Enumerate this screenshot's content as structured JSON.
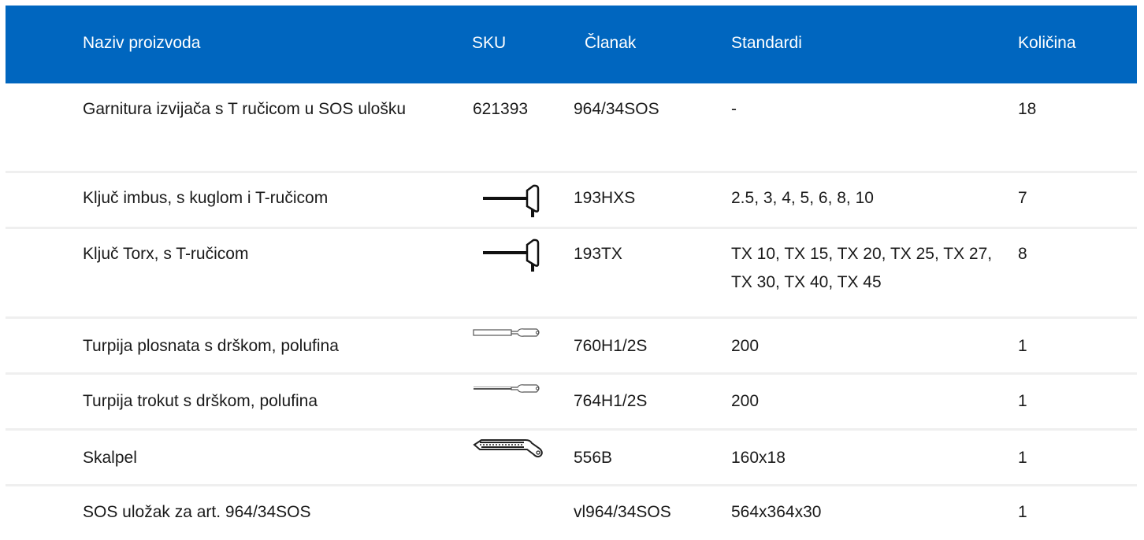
{
  "header": {
    "name": "Naziv proizvoda",
    "sku": "SKU",
    "article": "Članak",
    "standards": "Standardi",
    "quantity": "Količina"
  },
  "rows": [
    {
      "name": "Garnitura izvijača s T ručicom u SOS ulošku",
      "sku": "621393",
      "article": "964/34SOS",
      "standards": "-",
      "quantity": "18",
      "icon": null
    },
    {
      "name": "Ključ imbus, s kuglom i T-ručicom",
      "sku": "",
      "article": "193HXS",
      "standards": "2.5, 3, 4, 5, 6, 8, 10",
      "quantity": "7",
      "icon": "t-handle-hex-key-icon"
    },
    {
      "name": "Ključ Torx, s T-ručicom",
      "sku": "",
      "article": "193TX",
      "standards": "TX 10, TX 15, TX 20, TX 25, TX 27, TX 30, TX 40, TX 45",
      "quantity": "8",
      "icon": "t-handle-torx-key-icon"
    },
    {
      "name": "Turpija plosnata s drškom, polufina",
      "sku": "",
      "article": "760H1/2S",
      "standards": "200",
      "quantity": "1",
      "icon": "flat-file-icon"
    },
    {
      "name": "Turpija trokut s drškom, polufina",
      "sku": "",
      "article": "764H1/2S",
      "standards": "200",
      "quantity": "1",
      "icon": "triangular-file-icon"
    },
    {
      "name": "Skalpel",
      "sku": "",
      "article": "556B",
      "standards": "160x18",
      "quantity": "1",
      "icon": "utility-knife-icon"
    },
    {
      "name": "SOS uložak za art. 964/34SOS",
      "sku": "",
      "article": "vl964/34SOS",
      "standards": "564x364x30",
      "quantity": "1",
      "icon": null
    }
  ]
}
